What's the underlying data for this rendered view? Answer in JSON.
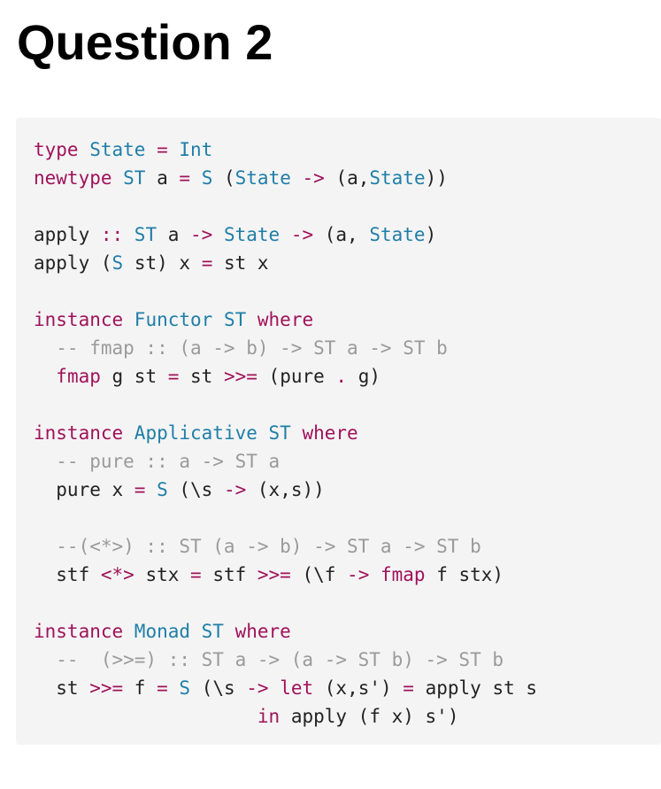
{
  "title": "Question 2",
  "code_lines": [
    [
      [
        "kw",
        "type"
      ],
      [
        "",
        ""
      ],
      [
        "ty",
        " State"
      ],
      [
        "kw",
        " ="
      ],
      [
        "ty",
        " Int"
      ]
    ],
    [
      [
        "kw",
        "newtype"
      ],
      [
        "ty",
        " ST"
      ],
      [
        "",
        " a "
      ],
      [
        "kw",
        "="
      ],
      [
        "ty",
        " S"
      ],
      [
        "",
        " ("
      ],
      [
        "ty",
        "State"
      ],
      [
        "kw",
        " ->"
      ],
      [
        "",
        " (a,"
      ],
      [
        "ty",
        "State"
      ],
      [
        "",
        "))"
      ]
    ],
    [],
    [
      [
        "",
        "apply "
      ],
      [
        "kw",
        "::"
      ],
      [
        "ty",
        " ST"
      ],
      [
        "",
        " a "
      ],
      [
        "kw",
        "->"
      ],
      [
        "ty",
        " State"
      ],
      [
        "kw",
        " ->"
      ],
      [
        "",
        " (a, "
      ],
      [
        "ty",
        "State"
      ],
      [
        "",
        ")"
      ]
    ],
    [
      [
        "",
        "apply ("
      ],
      [
        "ty",
        "S"
      ],
      [
        "",
        " st) x "
      ],
      [
        "kw",
        "="
      ],
      [
        "",
        " st x"
      ]
    ],
    [],
    [
      [
        "kw",
        "instance"
      ],
      [
        "ty",
        " Functor"
      ],
      [
        "ty",
        " ST"
      ],
      [
        "kw",
        " where"
      ]
    ],
    [
      [
        "cm",
        "  -- fmap :: (a -> b) -> ST a -> ST b"
      ]
    ],
    [
      [
        "",
        "  "
      ],
      [
        "kw",
        "fmap"
      ],
      [
        "",
        " g st "
      ],
      [
        "kw",
        "="
      ],
      [
        "",
        " st "
      ],
      [
        "kw",
        ">>="
      ],
      [
        "",
        " (pure "
      ],
      [
        "kw",
        "."
      ],
      [
        "",
        " g)"
      ]
    ],
    [],
    [
      [
        "kw",
        "instance"
      ],
      [
        "ty",
        " Applicative"
      ],
      [
        "ty",
        " ST"
      ],
      [
        "kw",
        " where"
      ]
    ],
    [
      [
        "cm",
        "  -- pure :: a -> ST a"
      ]
    ],
    [
      [
        "",
        "  pure x "
      ],
      [
        "kw",
        "="
      ],
      [
        "ty",
        " S"
      ],
      [
        "",
        " (\\s "
      ],
      [
        "kw",
        "->"
      ],
      [
        "",
        " (x,s))"
      ]
    ],
    [],
    [
      [
        "cm",
        "  --(<*>) :: ST (a -> b) -> ST a -> ST b"
      ]
    ],
    [
      [
        "",
        "  stf "
      ],
      [
        "kw",
        "<*>"
      ],
      [
        "",
        " stx "
      ],
      [
        "kw",
        "="
      ],
      [
        "",
        " stf "
      ],
      [
        "kw",
        ">>="
      ],
      [
        "",
        " (\\f "
      ],
      [
        "kw",
        "->"
      ],
      [
        "kw",
        " fmap"
      ],
      [
        "",
        " f stx)"
      ]
    ],
    [],
    [
      [
        "kw",
        "instance"
      ],
      [
        "ty",
        " Monad"
      ],
      [
        "ty",
        " ST"
      ],
      [
        "kw",
        " where"
      ]
    ],
    [
      [
        "cm",
        "  --  (>>=) :: ST a -> (a -> ST b) -> ST b"
      ]
    ],
    [
      [
        "",
        "  st "
      ],
      [
        "kw",
        ">>="
      ],
      [
        "",
        " f "
      ],
      [
        "kw",
        "="
      ],
      [
        "ty",
        " S"
      ],
      [
        "",
        " (\\s "
      ],
      [
        "kw",
        "->"
      ],
      [
        "kw",
        " let"
      ],
      [
        "",
        " (x,s') "
      ],
      [
        "kw",
        "="
      ],
      [
        "",
        " apply st s"
      ]
    ],
    [
      [
        "",
        "                    "
      ],
      [
        "kw",
        "in"
      ],
      [
        "",
        " apply (f x) s')"
      ]
    ]
  ]
}
